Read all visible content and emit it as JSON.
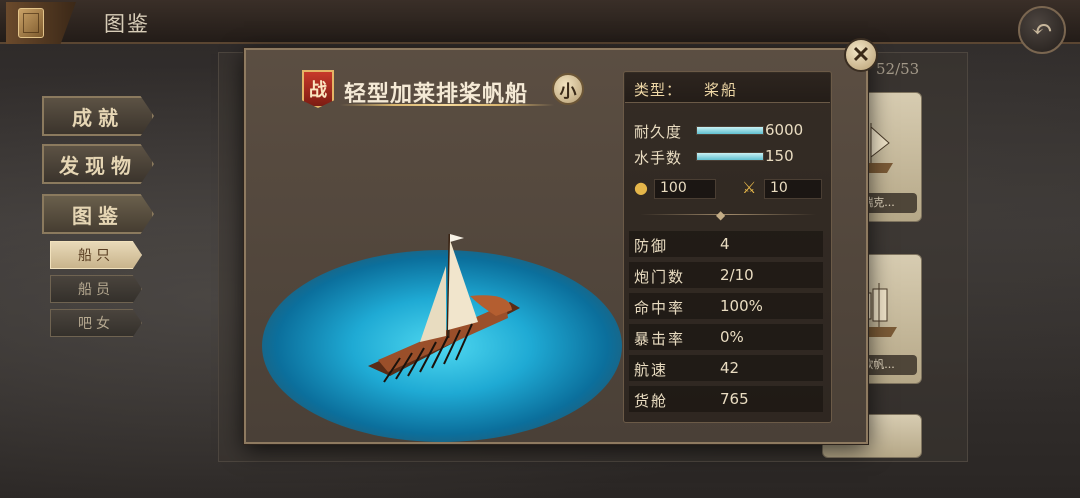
{
  "header": {
    "title": "图鉴",
    "back_icon": "back-arrow-icon"
  },
  "menu": {
    "main": [
      {
        "label": "成就"
      },
      {
        "label": "发现物"
      },
      {
        "label": "图鉴"
      }
    ],
    "sub": [
      {
        "label": "船只"
      },
      {
        "label": "船员"
      },
      {
        "label": "吧女"
      }
    ]
  },
  "collection": {
    "counter": "52/53",
    "visible_names": [
      "卡瑞克...",
      "北欧帆..."
    ]
  },
  "popup": {
    "close_glyph": "✕",
    "battle_badge": "战",
    "ship_name": "轻型加莱排桨帆船",
    "size_badge": "小",
    "type_label": "类型：",
    "type_value": "桨船",
    "durability": {
      "label": "耐久度",
      "value": "6000",
      "fraction": 1.0
    },
    "sailors": {
      "label": "水手数",
      "value": "150",
      "fraction": 1.0
    },
    "cannon_count": "100",
    "melee": "10",
    "attributes": [
      {
        "label": "防御",
        "value": "4"
      },
      {
        "label": "炮门数",
        "value": "2/10"
      },
      {
        "label": "命中率",
        "value": "100%"
      },
      {
        "label": "暴击率",
        "value": "0%"
      },
      {
        "label": "航速",
        "value": "42"
      },
      {
        "label": "货舱",
        "value": "765"
      }
    ]
  },
  "colors": {
    "accent_gold": "#d8b56f",
    "bar_cyan": "#5fbfcf",
    "battle_red": "#c7392a"
  }
}
